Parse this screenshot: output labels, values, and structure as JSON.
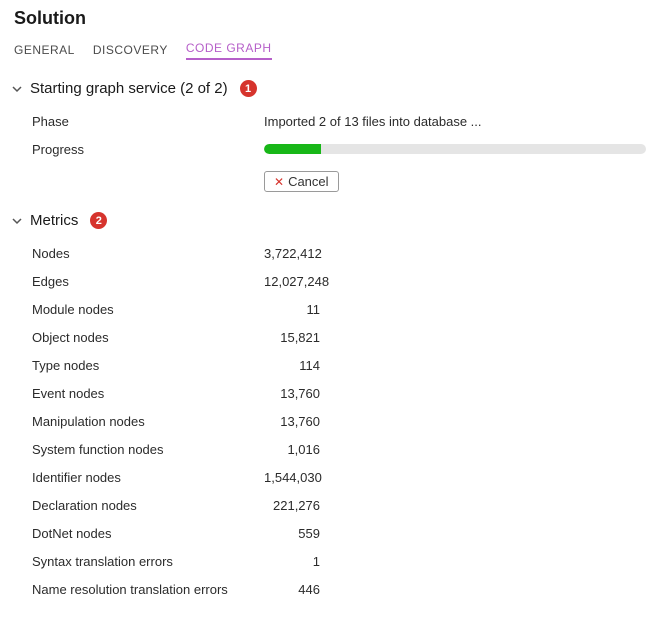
{
  "title": "Solution",
  "tabs": {
    "general": "General",
    "discovery": "Discovery",
    "code_graph": "Code Graph"
  },
  "service": {
    "header": "Starting graph service (2 of 2)",
    "badge": "1",
    "phase_label": "Phase",
    "phase_value": "Imported 2 of 13 files into database ...",
    "progress_label": "Progress",
    "progress_percent": 15,
    "cancel_label": "Cancel"
  },
  "metrics": {
    "header": "Metrics",
    "badge": "2",
    "rows": [
      {
        "label": "Nodes",
        "value": "3,722,412"
      },
      {
        "label": "Edges",
        "value": "12,027,248"
      },
      {
        "label": "Module nodes",
        "value": "11"
      },
      {
        "label": "Object nodes",
        "value": "15,821"
      },
      {
        "label": "Type nodes",
        "value": "114"
      },
      {
        "label": "Event nodes",
        "value": "13,760"
      },
      {
        "label": "Manipulation nodes",
        "value": "13,760"
      },
      {
        "label": "System function nodes",
        "value": "1,016"
      },
      {
        "label": "Identifier nodes",
        "value": "1,544,030"
      },
      {
        "label": "Declaration nodes",
        "value": "221,276"
      },
      {
        "label": "DotNet nodes",
        "value": "559"
      },
      {
        "label": "Syntax translation errors",
        "value": "1"
      },
      {
        "label": "Name resolution translation errors",
        "value": "446"
      }
    ]
  }
}
